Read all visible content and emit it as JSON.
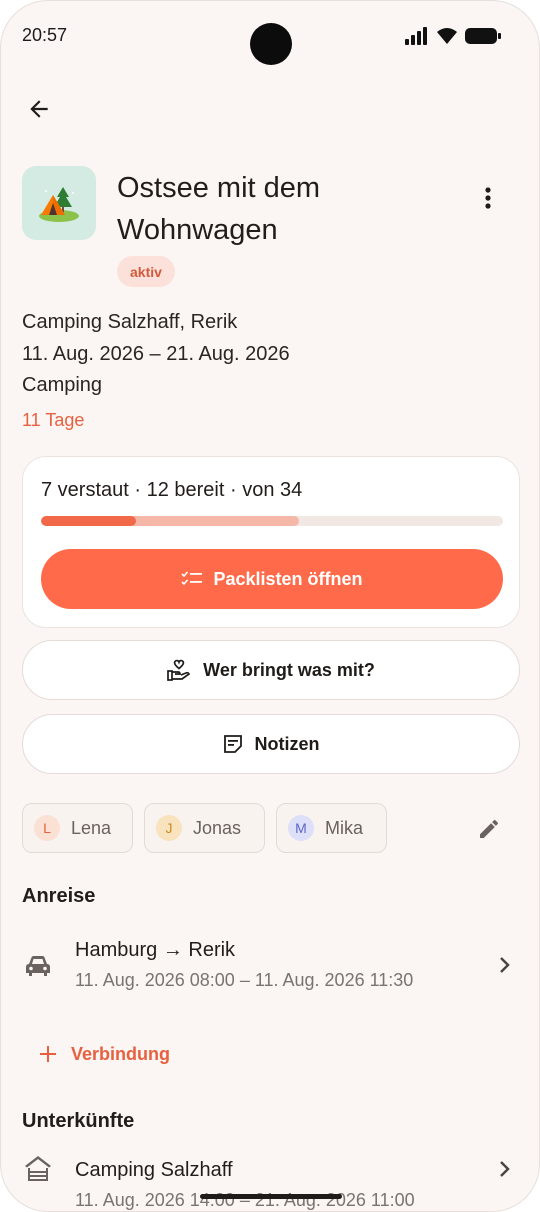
{
  "status_bar": {
    "time": "20:57"
  },
  "trip": {
    "title": "Ostsee mit dem Wohnwagen",
    "status": "aktiv",
    "location": "Camping Salzhaff, Rerik",
    "dates": "11. Aug. 2026 – 21. Aug. 2026",
    "type": "Camping",
    "duration": "11 Tage"
  },
  "packing": {
    "summary": "7 verstaut · 12 bereit · von 34",
    "stowed": 7,
    "ready": 12,
    "total": 34,
    "open_button": "Packlisten öffnen"
  },
  "actions": {
    "who_brings": "Wer bringt was mit?",
    "notes": "Notizen"
  },
  "participants": [
    {
      "initial": "L",
      "name": "Lena",
      "color": "#fbe0d4",
      "text_color": "#e7603f"
    },
    {
      "initial": "J",
      "name": "Jonas",
      "color": "#f9e3bf",
      "text_color": "#c98c1f"
    },
    {
      "initial": "M",
      "name": "Mika",
      "color": "#dde0f8",
      "text_color": "#5a67c9"
    }
  ],
  "travel": {
    "section_title": "Anreise",
    "route_from": "Hamburg",
    "route_arrow": "→",
    "route_to": "Rerik",
    "time": "11. Aug. 2026 08:00 – 11. Aug. 2026 11:30",
    "add_label": "Verbindung"
  },
  "accommodations": {
    "section_title": "Unterkünfte",
    "name": "Camping Salzhaff",
    "time": "11. Aug. 2026 14:00 – 21. Aug. 2026 11:00"
  },
  "colors": {
    "accent": "#ff6b4a",
    "background": "#fbf6f3"
  }
}
